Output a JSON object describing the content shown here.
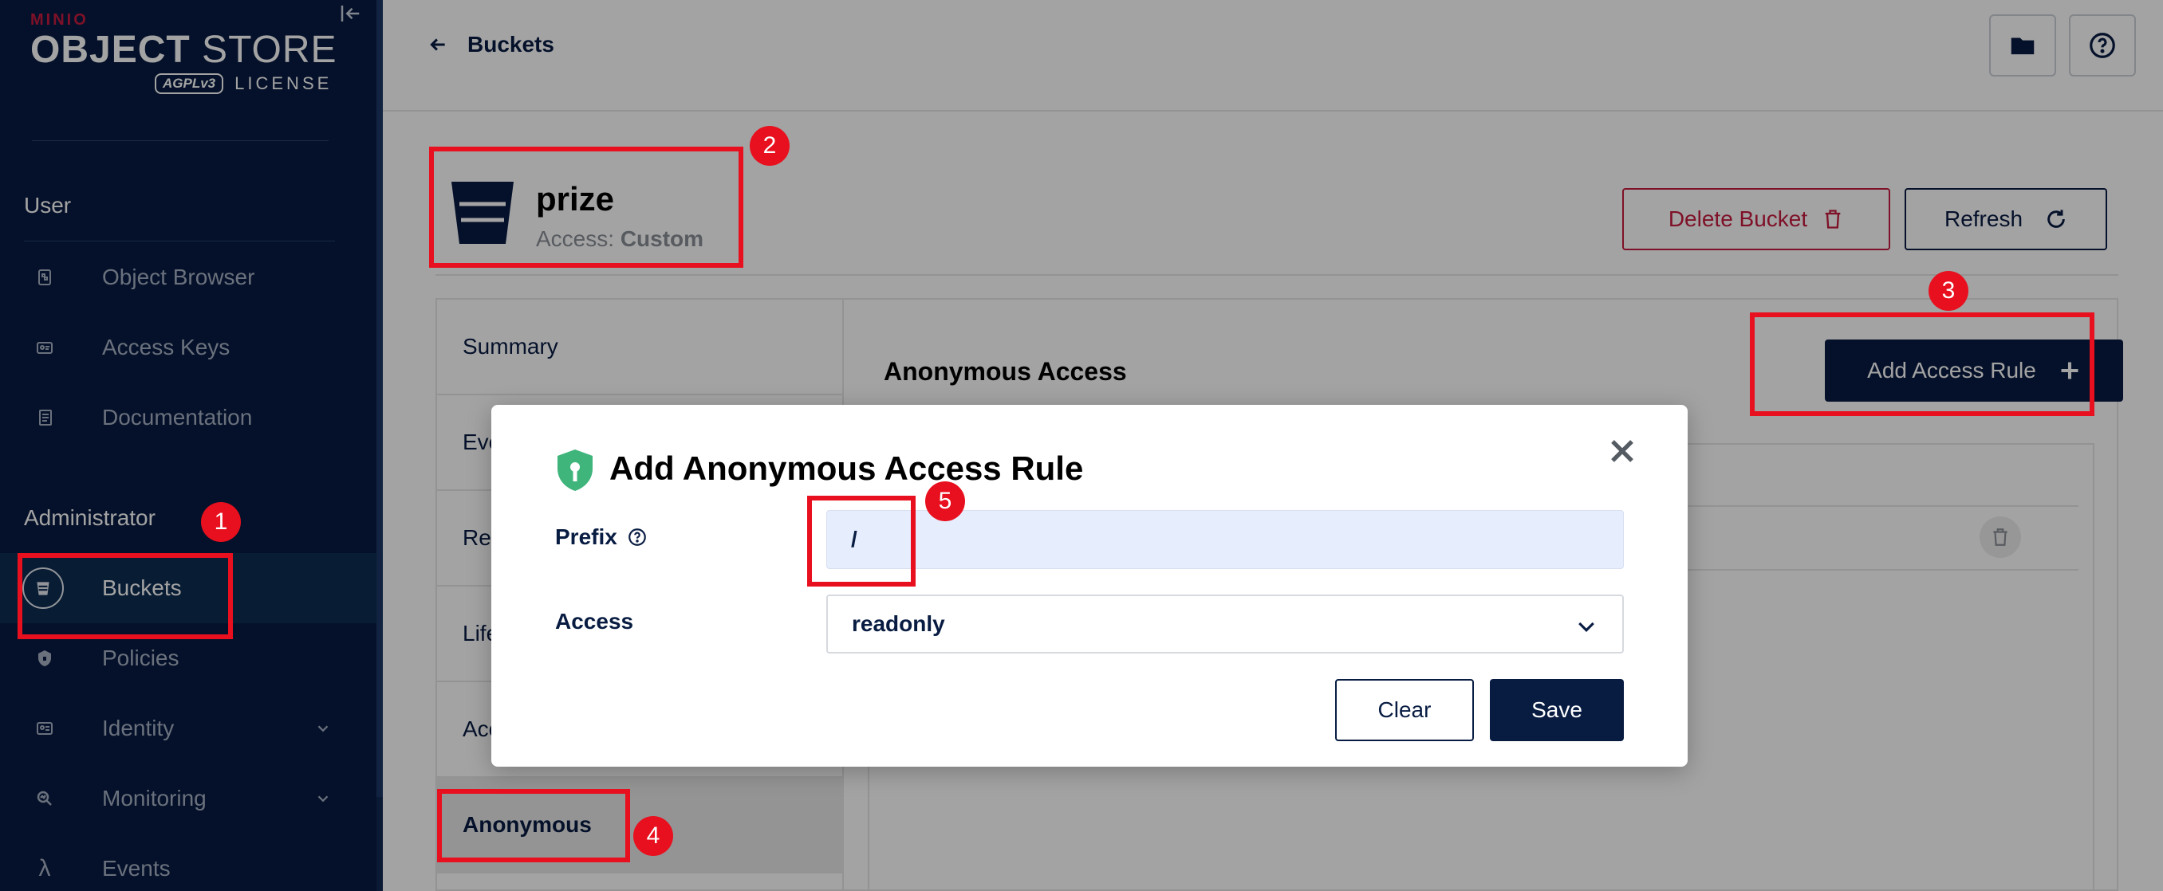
{
  "brand": {
    "vendor": "MINIO",
    "product_bold": "OBJECT",
    "product_light": "STORE",
    "agpl": "AGPLv3",
    "license": "LICENSE"
  },
  "sidebar": {
    "user_section": "User",
    "admin_section": "Administrator",
    "user_items": [
      {
        "label": "Object Browser",
        "icon": "object-browser-icon"
      },
      {
        "label": "Access Keys",
        "icon": "access-keys-icon"
      },
      {
        "label": "Documentation",
        "icon": "documentation-icon"
      }
    ],
    "admin_items": [
      {
        "label": "Buckets",
        "icon": "bucket-icon",
        "active": true
      },
      {
        "label": "Policies",
        "icon": "policies-icon"
      },
      {
        "label": "Identity",
        "icon": "identity-icon",
        "expandable": true
      },
      {
        "label": "Monitoring",
        "icon": "monitoring-icon",
        "expandable": true
      },
      {
        "label": "Events",
        "icon": "lambda-icon"
      }
    ]
  },
  "topbar": {
    "back_label": "Buckets"
  },
  "bucket": {
    "name": "prize",
    "access_label": "Access:",
    "access_value": "Custom",
    "delete_label": "Delete Bucket",
    "refresh_label": "Refresh"
  },
  "tabs": [
    {
      "label": "Summary"
    },
    {
      "label": "Eve"
    },
    {
      "label": "Re"
    },
    {
      "label": "Life"
    },
    {
      "label": "Acc"
    },
    {
      "label": "Anonymous",
      "active": true
    }
  ],
  "content": {
    "title": "Anonymous Access",
    "add_rule_label": "Add Access Rule"
  },
  "modal": {
    "title": "Add Anonymous Access Rule",
    "prefix_label": "Prefix",
    "prefix_value": "/",
    "access_label": "Access",
    "access_value": "readonly",
    "clear_label": "Clear",
    "save_label": "Save"
  },
  "annotations": [
    "1",
    "2",
    "3",
    "4",
    "5"
  ],
  "colors": {
    "sidebar_bg": "#081c42",
    "primary": "#081c42",
    "danger": "#c51c3f",
    "highlight": "#e8101e",
    "shield_green": "#3fb47b"
  }
}
